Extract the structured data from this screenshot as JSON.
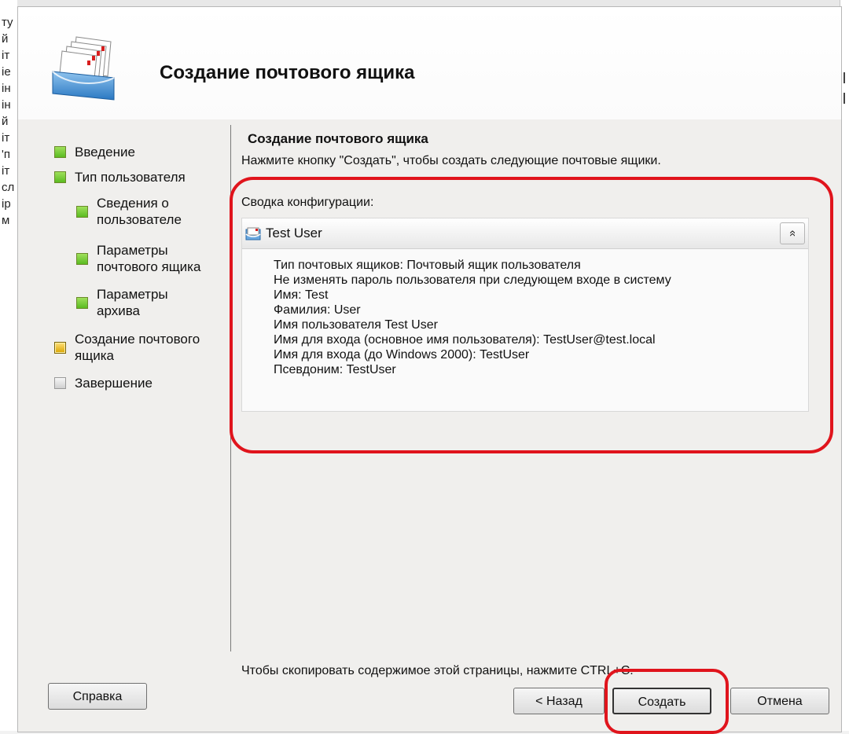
{
  "background": {
    "left_fragments": [
      "ту",
      "й",
      "іт",
      "іе",
      "ін",
      "ін",
      "й",
      "іт",
      "'п",
      "іт",
      "сл",
      "ір",
      "м"
    ]
  },
  "dialog": {
    "title": "Создание почтового ящика",
    "header_icon": "mailbox-icon"
  },
  "steps": [
    {
      "label": "Введение",
      "status": "done"
    },
    {
      "label": "Тип пользователя",
      "status": "done"
    },
    {
      "label": "Сведения о пользователе",
      "status": "done"
    },
    {
      "label": "Параметры почтового ящика",
      "status": "done"
    },
    {
      "label": "Параметры архива",
      "status": "done"
    },
    {
      "label": "Создание почтового ящика",
      "status": "current"
    },
    {
      "label": "Завершение",
      "status": "pending"
    }
  ],
  "content": {
    "section_title": "Создание почтового ящика",
    "description": "Нажмите кнопку \"Создать\", чтобы создать следующие почтовые ящики.",
    "summary_label": "Сводка конфигурации:",
    "summary": {
      "item_name": "Test User",
      "collapse_glyph": "»",
      "lines": [
        "Тип почтовых ящиков: Почтовый ящик пользователя",
        "Не изменять пароль пользователя при следующем входе в систему",
        "Имя: Test",
        "Фамилия: User",
        "Имя пользователя Test User",
        "Имя для входа (основное имя пользователя): TestUser@test.local",
        "Имя для входа (до Windows 2000): TestUser",
        "Псевдоним: TestUser"
      ]
    },
    "copy_hint": "Чтобы скопировать содержимое этой страницы, нажмите CTRL+C."
  },
  "buttons": {
    "help": "Справка",
    "back": "< Назад",
    "create": "Создать",
    "cancel": "Отмена"
  },
  "colors": {
    "highlight": "#e0141c",
    "step_done": "#5bbb21",
    "step_current": "#d9a400",
    "step_pending": "#cfcfcf"
  }
}
